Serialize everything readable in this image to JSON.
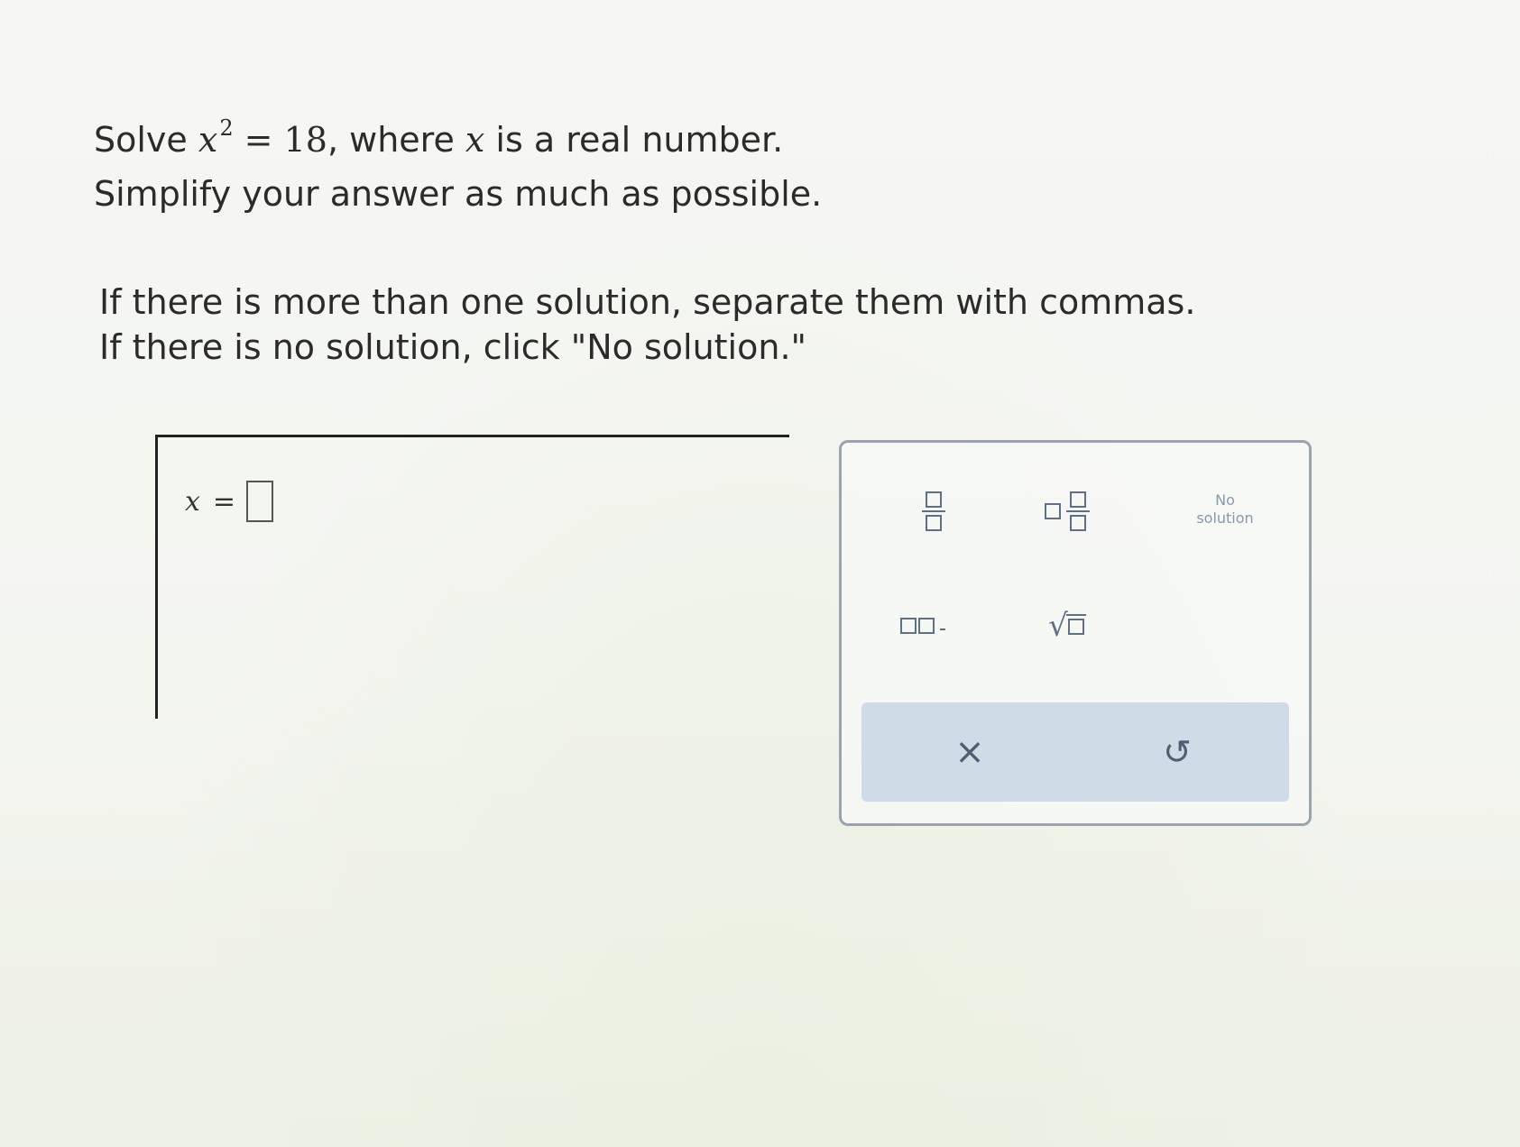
{
  "question": {
    "prefix": "Solve ",
    "var": "x",
    "exponent": "2",
    "equals": " = ",
    "value": "18",
    "middle": ", where ",
    "var2": "x",
    "suffix": " is a real number.",
    "line2": "Simplify your answer as much as possible."
  },
  "instructions": {
    "line1": "If there is more than one solution, separate them with commas.",
    "line2": "If there is no solution, click \"No solution.\""
  },
  "answer": {
    "var": "x",
    "equals": "=",
    "value": ""
  },
  "palette": {
    "no_solution_line1": "No",
    "no_solution_line2": "solution",
    "clear_glyph": "×",
    "undo_glyph": "↺"
  },
  "colors": {
    "text": "#2b2b2b",
    "palette_border": "#9aa4b0",
    "palette_icon": "#5f6f86",
    "action_bar": "#cfdbe6"
  },
  "icons": [
    "fraction-icon",
    "mixed-number-icon",
    "list-icon",
    "square-root-icon",
    "clear-icon",
    "undo-icon"
  ]
}
